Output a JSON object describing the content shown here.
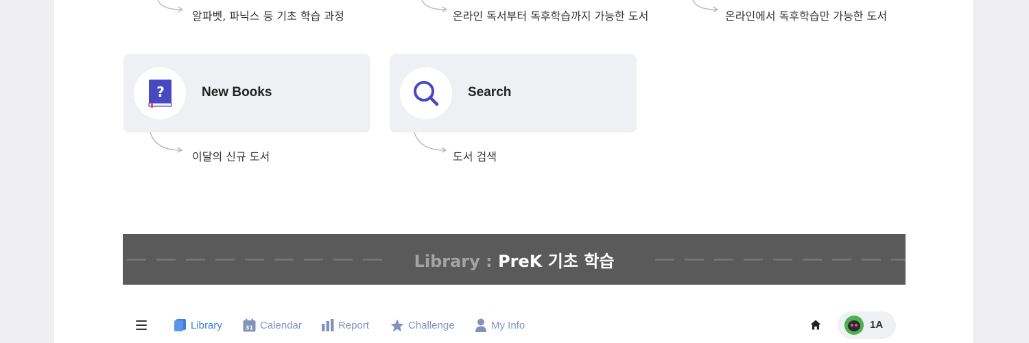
{
  "captions_top": [
    "알파벳, 파닉스 등 기초 학습 과정",
    "온라인 독서부터 독후학습까지 가능한 도서",
    "온라인에서 독후학습만 가능한 도서"
  ],
  "cards": [
    {
      "label": "New Books",
      "icon": "book-question-icon",
      "caption": "이달의 신규 도서"
    },
    {
      "label": "Search",
      "icon": "magnifier-icon",
      "caption": "도서 검색"
    }
  ],
  "banner": {
    "prefix": "Library :",
    "title": "PreK 기초 학습"
  },
  "nav": {
    "items": [
      {
        "label": "Library",
        "icon": "book-icon",
        "active": true
      },
      {
        "label": "Calendar",
        "icon": "calendar-icon",
        "badge": "31"
      },
      {
        "label": "Report",
        "icon": "bar-chart-icon"
      },
      {
        "label": "Challenge",
        "icon": "star-icon"
      },
      {
        "label": "My Info",
        "icon": "person-icon"
      }
    ],
    "user_class": "1A"
  },
  "colors": {
    "active": "#3e7ee0",
    "inactive": "#8193bd",
    "card_bg": "#eff0f4",
    "banner_bg": "#5a5a5a",
    "icon_purple": "#4848c0"
  }
}
